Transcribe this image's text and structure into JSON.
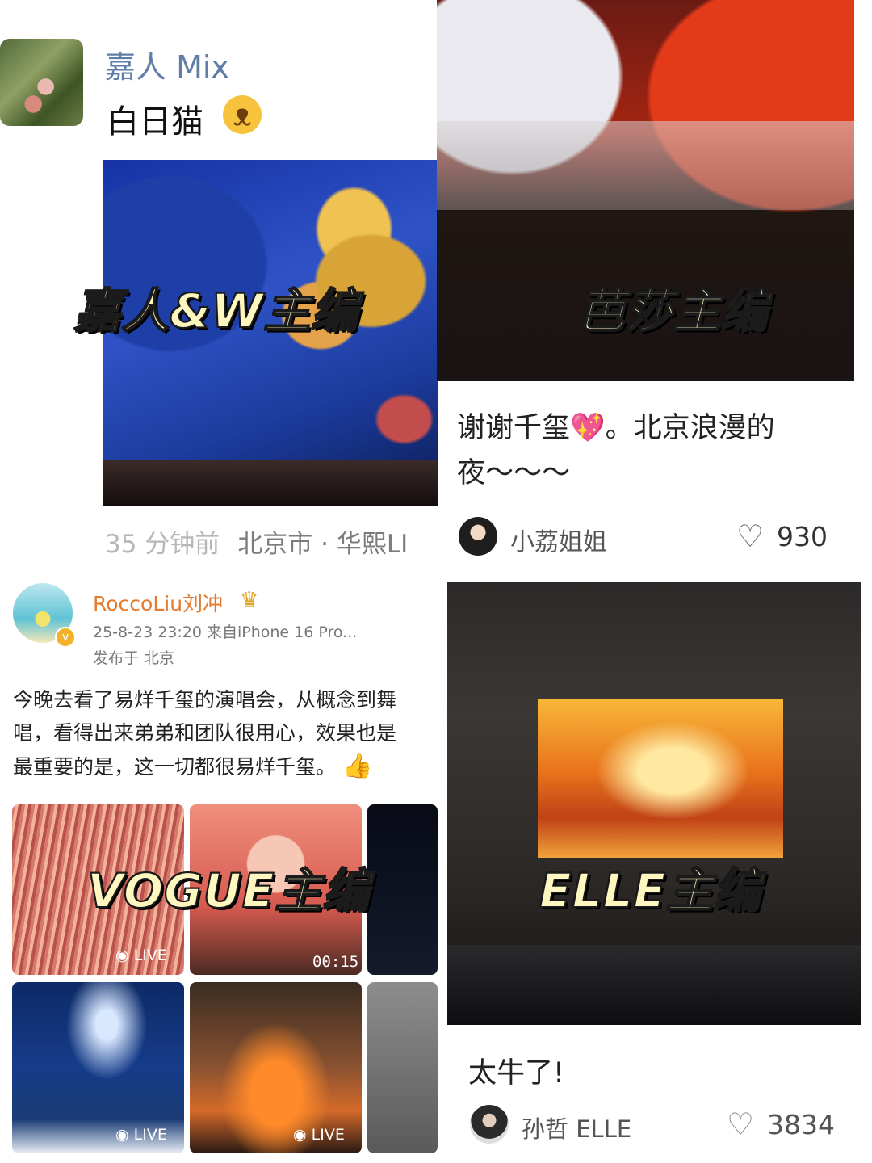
{
  "tl": {
    "name": "嘉人 Mix",
    "text": "白日猫",
    "emoji": "🐱",
    "overlay": "嘉人&W主编",
    "time": "35 分钟前",
    "location": "北京市 · 华熙LI"
  },
  "tr": {
    "overlay": "芭莎主编",
    "caption_line1": "谢谢千玺💖。北京浪漫的",
    "caption_line2": "夜～～～",
    "author": "小荔姐姐",
    "likes": "930"
  },
  "bl": {
    "name": "RoccoLiu刘冲",
    "time": "25-8-23 23:20  来自iPhone 16 Pro...",
    "pub": "发布于 北京",
    "line1": "今晚去看了易烊千玺的演唱会，从概念到舞",
    "line2": "唱，看得出来弟弟和团队很用心，效果也是",
    "line3": "最重要的是，这一切都很易烊千玺。",
    "overlay": "VOGUE主编",
    "thumbs": {
      "t1_badge": "LIVE",
      "t2_duration": "00:15",
      "t4_badge": "LIVE",
      "t5_badge": "LIVE"
    }
  },
  "br": {
    "overlay": "ELLE主编",
    "caption": "太牛了!",
    "author": "孙哲 ELLE",
    "likes": "3834"
  },
  "icons": {
    "heart": "heart-outline-icon",
    "live": "live-icon",
    "crown": "crown-icon",
    "verified": "verified-badge-icon",
    "thumbs_up": "thumbs-up-icon"
  }
}
